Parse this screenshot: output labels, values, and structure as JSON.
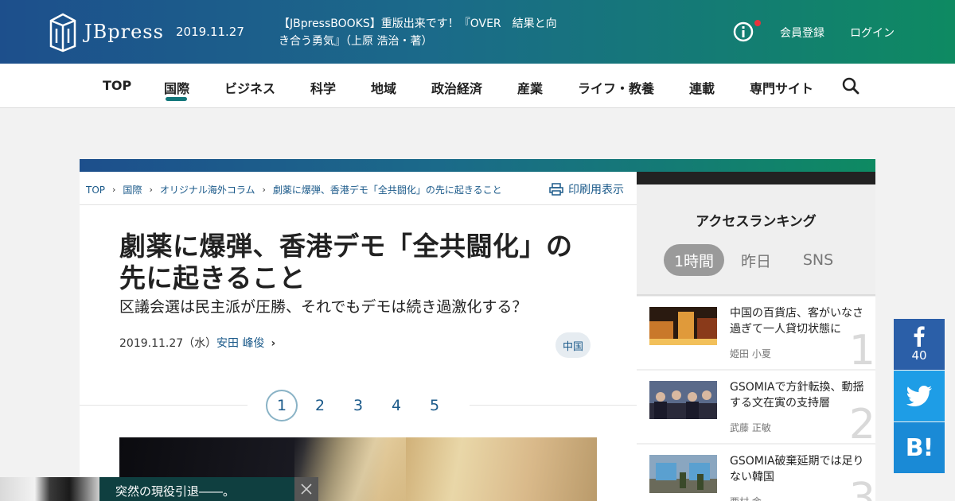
{
  "header": {
    "logo_text": "JBpress",
    "date": "2019.11.27",
    "news_ticker": "【JBpressBOOKS】重版出来です！『OVER　結果と向き合う勇気』（上原 浩治・著）",
    "register_label": "会員登録",
    "login_label": "ログイン",
    "info_icon": "info-icon"
  },
  "nav": {
    "items": [
      "TOP",
      "国際",
      "ビジネス",
      "科学",
      "地域",
      "政治経済",
      "産業",
      "ライフ・教養",
      "連載",
      "専門サイト"
    ],
    "active": "国際",
    "search_icon": "search-icon"
  },
  "breadcrumb": [
    "TOP",
    "国際",
    "オリジナル海外コラム",
    "劇薬に爆弾、香港デモ「全共闘化」の先に起きること"
  ],
  "print_label": "印刷用表示",
  "article": {
    "title": "劇薬に爆弾、香港デモ「全共闘化」の先に起きること",
    "subtitle": "区議会選は民主派が圧勝、それでもデモは続き過激化する？",
    "date": "2019.11.27（水）",
    "author": "安田 峰俊",
    "tag": "中国",
    "pages": [
      "1",
      "2",
      "3",
      "4",
      "5"
    ],
    "current_page": "1"
  },
  "ranking": {
    "heading": "アクセスランキング",
    "tabs": [
      "1時間",
      "昨日",
      "SNS"
    ],
    "active_tab": "1時間",
    "items": [
      {
        "rank": "1",
        "title": "中国の百貨店、客がいなさ過ぎて一人貸切状態に",
        "author": "姫田 小夏"
      },
      {
        "rank": "2",
        "title": "GSOMIAで方針転換、動揺する文在寅の支持層",
        "author": "武藤 正敏"
      },
      {
        "rank": "3",
        "title": "GSOMIA破棄延期では足りない韓国",
        "author": "西村 金一"
      }
    ]
  },
  "share": {
    "facebook_count": "40",
    "hatena_label": "B!"
  },
  "popup": {
    "text": "突然の現役引退――。"
  },
  "colors": {
    "brand_gradient_start": "#1d4f8c",
    "brand_gradient_end": "#0e8a62",
    "link": "#1b5a8a",
    "nav_active": "#12767a"
  }
}
